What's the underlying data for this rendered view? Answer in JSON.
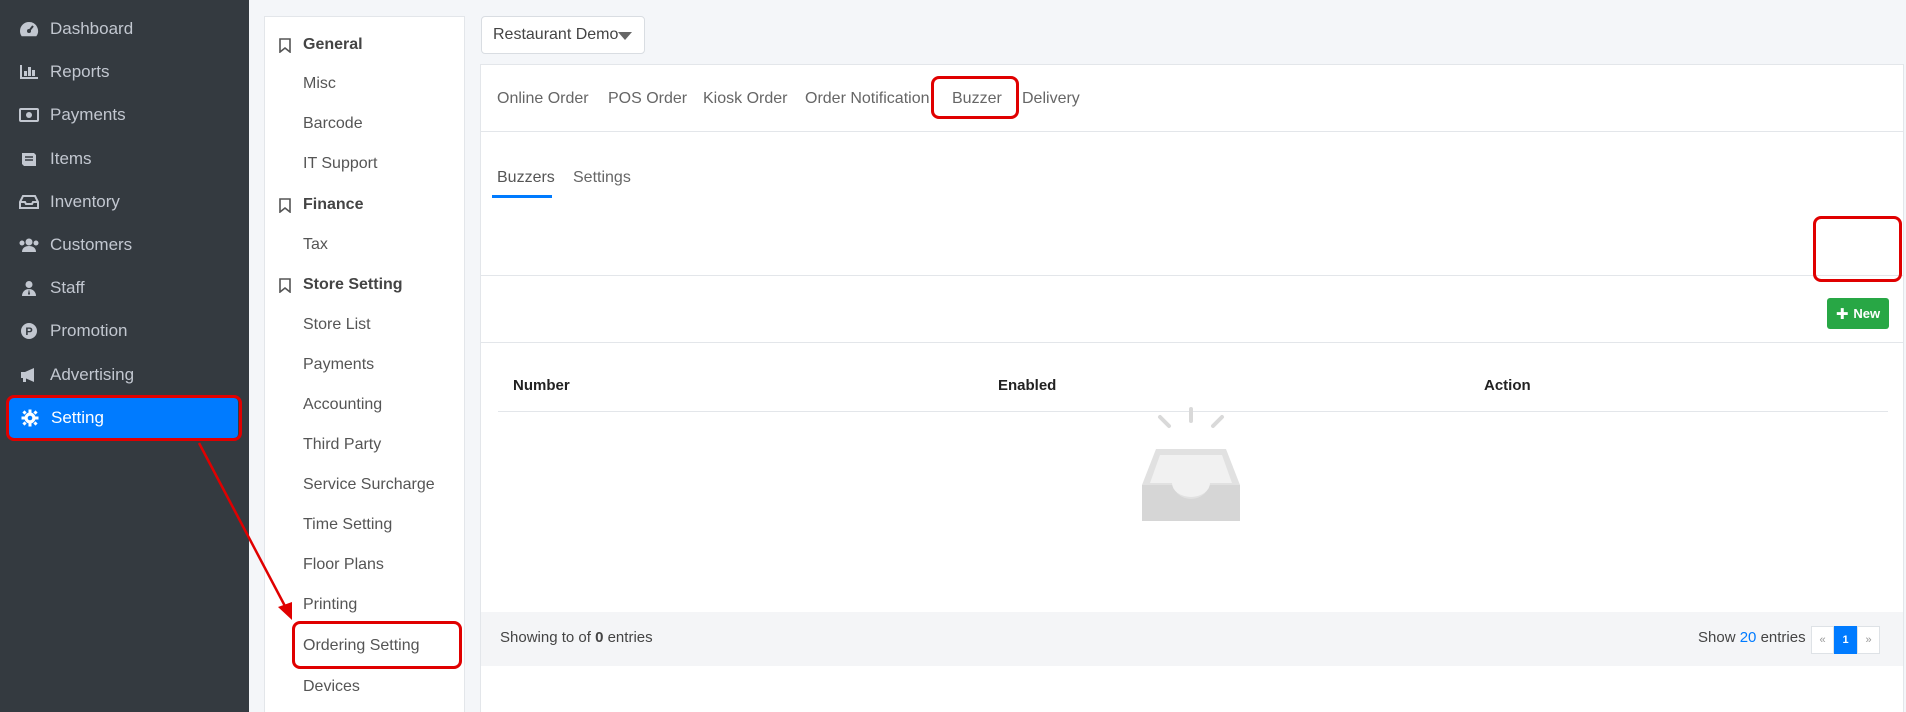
{
  "nav": {
    "items": [
      {
        "label": "Dashboard",
        "icon": "dashboard-icon"
      },
      {
        "label": "Reports",
        "icon": "bar-chart-icon"
      },
      {
        "label": "Payments",
        "icon": "money-icon"
      },
      {
        "label": "Items",
        "icon": "book-icon"
      },
      {
        "label": "Inventory",
        "icon": "inbox-icon"
      },
      {
        "label": "Customers",
        "icon": "users-icon"
      },
      {
        "label": "Staff",
        "icon": "user-tie-icon"
      },
      {
        "label": "Promotion",
        "icon": "promotion-icon"
      },
      {
        "label": "Advertising",
        "icon": "megaphone-icon"
      },
      {
        "label": "Setting",
        "icon": "gear-icon"
      }
    ],
    "active_index": 9
  },
  "settings_menu": {
    "sections": [
      {
        "title": "General",
        "items": [
          "Misc",
          "Barcode",
          "IT Support"
        ]
      },
      {
        "title": "Finance",
        "items": [
          "Tax"
        ]
      },
      {
        "title": "Store Setting",
        "items": [
          "Store List",
          "Payments",
          "Accounting",
          "Third Party",
          "Service Surcharge",
          "Time Setting",
          "Floor Plans",
          "Printing",
          "Ordering Setting",
          "Devices"
        ]
      }
    ]
  },
  "store_select": {
    "value": "Restaurant Demo"
  },
  "top_tabs": [
    "Online Order",
    "POS Order",
    "Kiosk Order",
    "Order Notification",
    "Buzzer",
    "Delivery"
  ],
  "sub_tabs": [
    "Buzzers",
    "Settings"
  ],
  "toolbar": {
    "new_label": "New"
  },
  "table": {
    "columns": [
      "Number",
      "Enabled",
      "Action"
    ],
    "rows": []
  },
  "footer": {
    "showing_prefix": "Showing to of",
    "showing_count": "0",
    "showing_suffix": "entries",
    "show_label": "Show",
    "page_size": "20",
    "entries_label": "entries"
  },
  "pager": {
    "prev": "«",
    "current": "1",
    "next": "»"
  },
  "colors": {
    "nav_bg": "#343a40",
    "active_blue": "#007bff",
    "new_green": "#28a745",
    "annotation_red": "#e00000"
  }
}
